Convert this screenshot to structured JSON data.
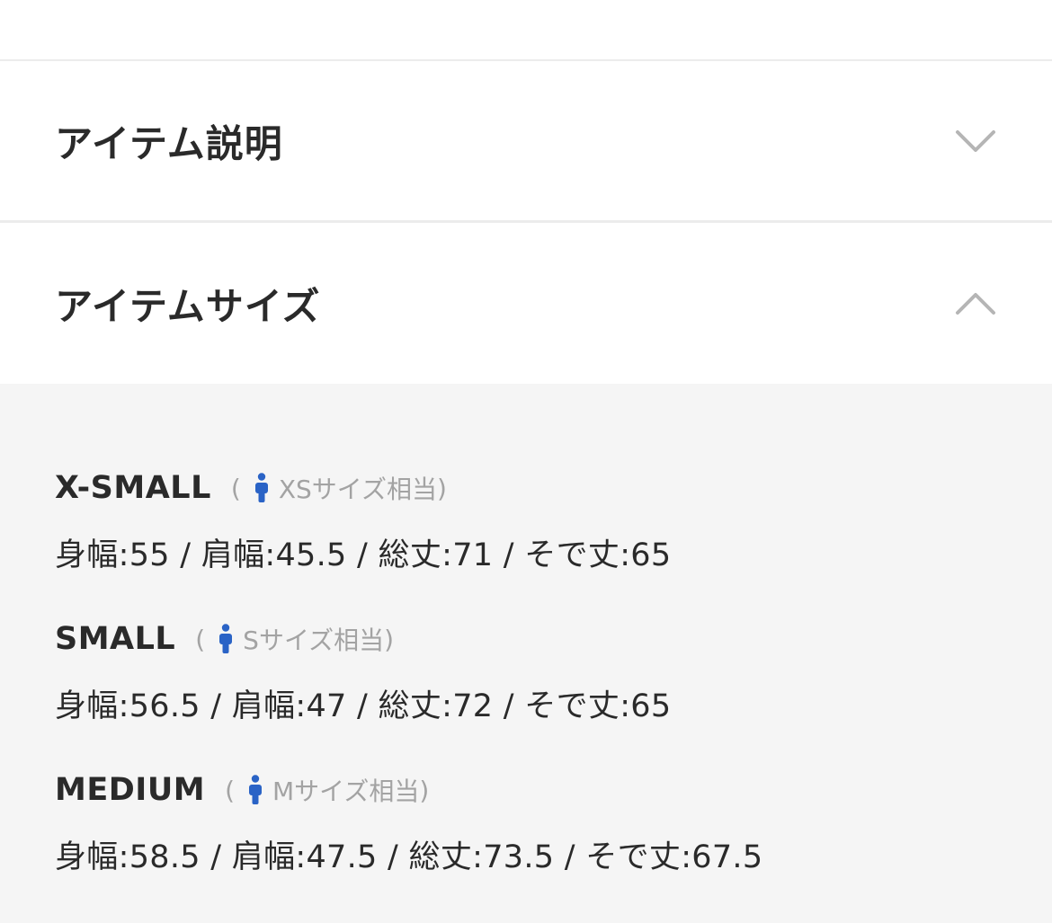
{
  "sections": {
    "description": {
      "title": "アイテム説明",
      "expanded": false
    },
    "size": {
      "title": "アイテムサイズ",
      "expanded": true
    }
  },
  "sizes": [
    {
      "name": "X-SMALL",
      "paren_open": "(",
      "equiv": "XSサイズ相当",
      "paren_close": ")",
      "measurements": "身幅:55 / 肩幅:45.5 / 総丈:71 / そで丈:65"
    },
    {
      "name": "SMALL",
      "paren_open": "(",
      "equiv": "Sサイズ相当",
      "paren_close": ")",
      "measurements": "身幅:56.5 / 肩幅:47 / 総丈:72 / そで丈:65"
    },
    {
      "name": "MEDIUM",
      "paren_open": "(",
      "equiv": "Mサイズ相当",
      "paren_close": ")",
      "measurements": "身幅:58.5 / 肩幅:47.5 / 総丈:73.5 / そで丈:67.5"
    }
  ],
  "colors": {
    "accent_icon": "#2a63c6",
    "panel_bg": "#f5f5f5",
    "muted_text": "#a3a3a3",
    "chevron": "#b5b5b5"
  },
  "icons": {
    "collapsed": "chevron-down-icon",
    "expanded": "chevron-up-icon",
    "size_equiv": "person-icon"
  }
}
